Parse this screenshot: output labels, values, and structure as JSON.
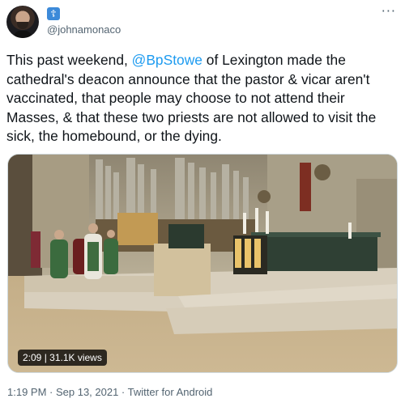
{
  "author": {
    "handle": "@johnamonaco",
    "badge_icon": "cross-icon",
    "badge_glyph": "☦"
  },
  "menu": {
    "more_glyph": "···"
  },
  "tweet": {
    "text_before": "This past weekend, ",
    "mention": "@BpStowe",
    "text_after": " of Lexington made the cathedral's deacon announce that the pastor & vicar aren't vaccinated, that people may choose to not attend their Masses, & that these two priests are not allowed to visit the sick, the homebound, or the dying.",
    "mention_color": "#1d9bf0"
  },
  "video": {
    "duration_views": "2:09 | 31.1K views"
  },
  "footer": {
    "timestamp": "1:19 PM · Sep 13, 2021 · Twitter for Android"
  }
}
